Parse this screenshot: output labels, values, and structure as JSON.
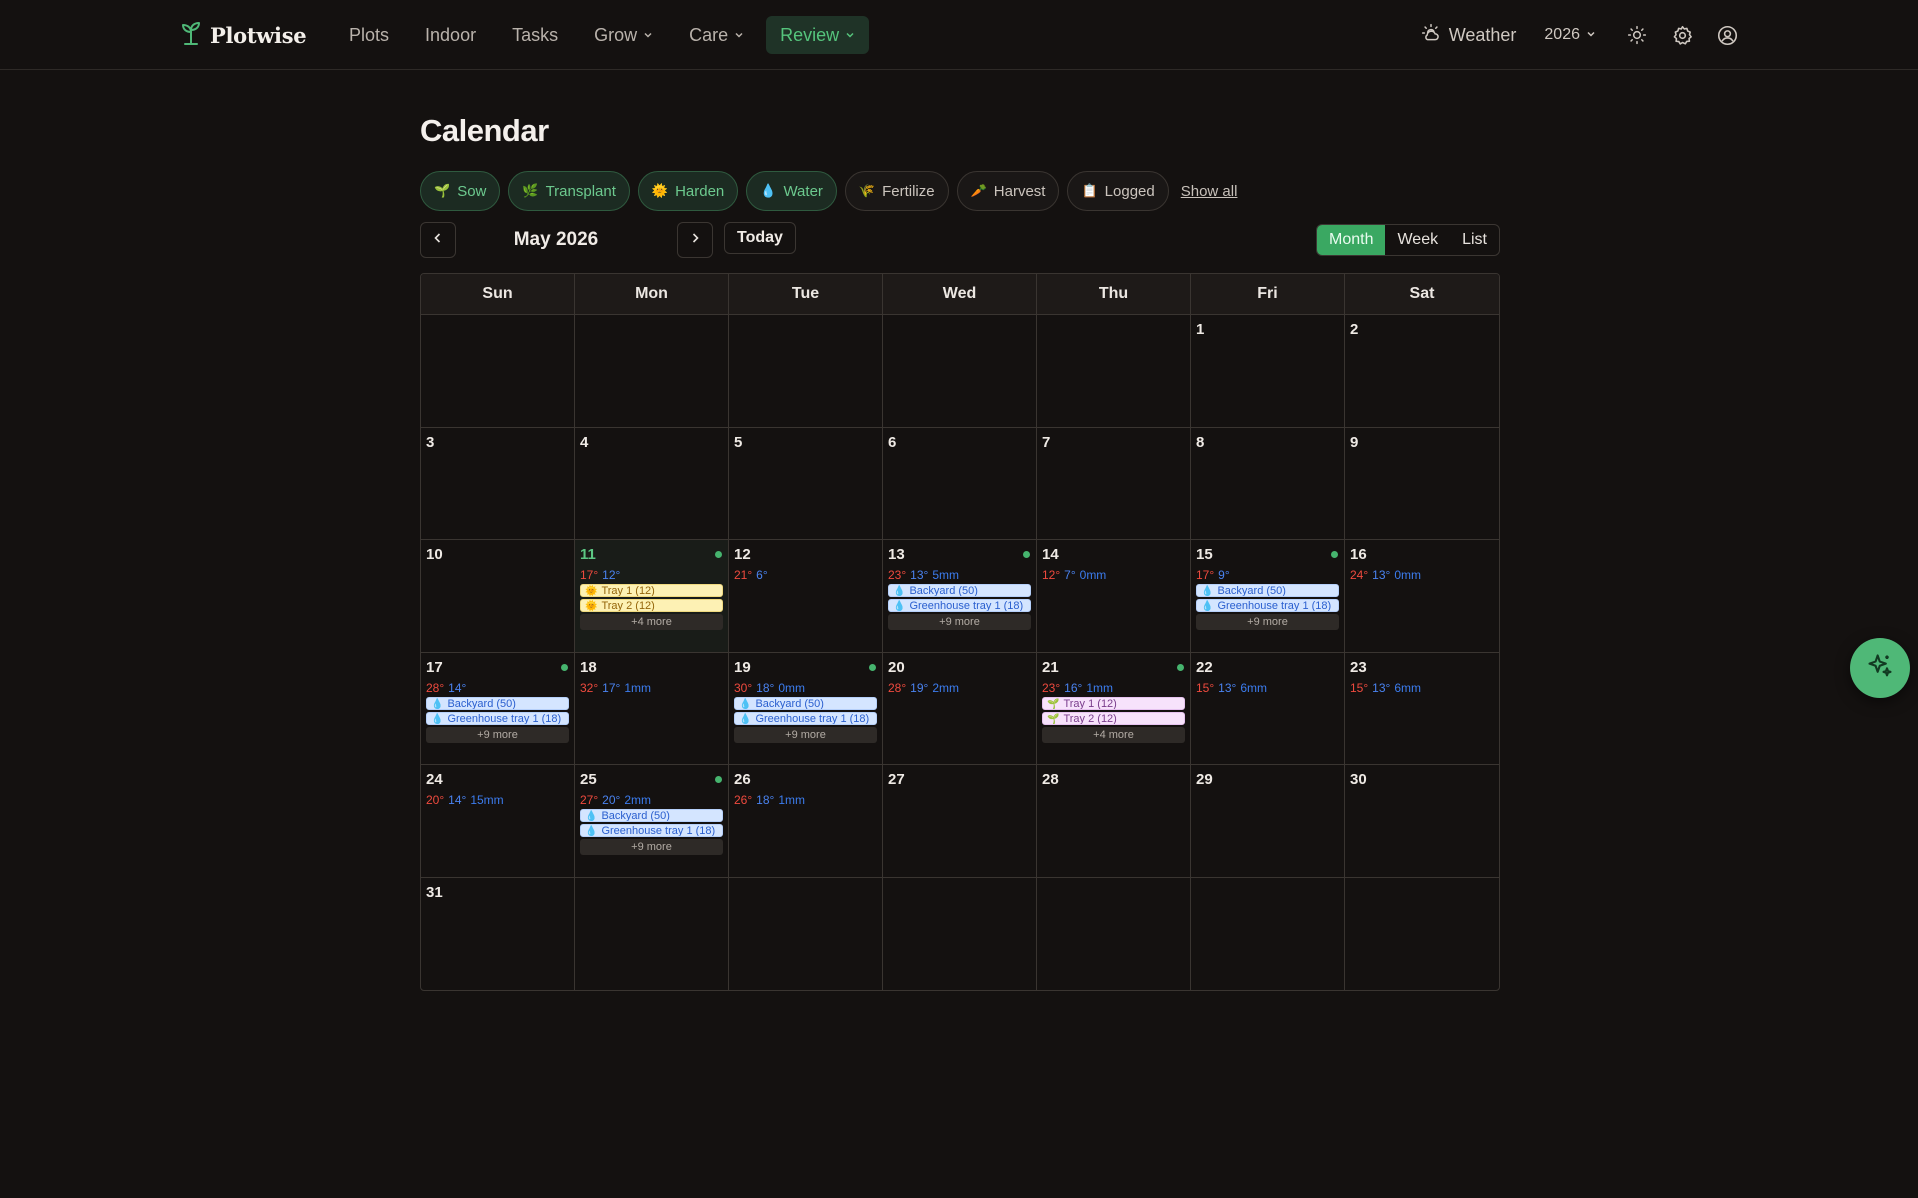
{
  "brand": {
    "name": "Plotwise",
    "accent": "#4fb877"
  },
  "nav": {
    "items": [
      {
        "label": "Plots",
        "dropdown": false
      },
      {
        "label": "Indoor",
        "dropdown": false
      },
      {
        "label": "Tasks",
        "dropdown": false
      },
      {
        "label": "Grow",
        "dropdown": true
      },
      {
        "label": "Care",
        "dropdown": true
      },
      {
        "label": "Review",
        "dropdown": true,
        "active": true
      }
    ],
    "weather_label": "Weather",
    "year": "2026",
    "icons": [
      "sun-icon",
      "gear-icon",
      "user-circle-icon"
    ]
  },
  "page": {
    "title": "Calendar"
  },
  "filters": {
    "chips": [
      {
        "emoji": "🌱",
        "label": "Sow",
        "active": true
      },
      {
        "emoji": "🌿",
        "label": "Transplant",
        "active": true
      },
      {
        "emoji": "🌞",
        "label": "Harden",
        "active": true
      },
      {
        "emoji": "💧",
        "label": "Water",
        "active": true
      },
      {
        "emoji": "🌾",
        "label": "Fertilize",
        "active": false
      },
      {
        "emoji": "🥕",
        "label": "Harvest",
        "active": false
      },
      {
        "emoji": "📋",
        "label": "Logged",
        "active": false
      }
    ],
    "show_all": "Show all"
  },
  "calendar_nav": {
    "month_label": "May 2026",
    "today_label": "Today",
    "views": [
      {
        "label": "Month",
        "selected": true
      },
      {
        "label": "Week",
        "selected": false
      },
      {
        "label": "List",
        "selected": false
      }
    ]
  },
  "weekdays": [
    "Sun",
    "Mon",
    "Tue",
    "Wed",
    "Thu",
    "Fri",
    "Sat"
  ],
  "days": [
    {
      "day": ""
    },
    {
      "day": ""
    },
    {
      "day": ""
    },
    {
      "day": ""
    },
    {
      "day": ""
    },
    {
      "day": "1"
    },
    {
      "day": "2"
    },
    {
      "day": "3"
    },
    {
      "day": "4"
    },
    {
      "day": "5"
    },
    {
      "day": "6"
    },
    {
      "day": "7"
    },
    {
      "day": "8"
    },
    {
      "day": "9"
    },
    {
      "day": "10"
    },
    {
      "day": "11",
      "today": true,
      "dot": true,
      "hi": "17°",
      "lo": "12°",
      "rain": "",
      "events": [
        {
          "type": "harden",
          "emoji": "🌞",
          "label": "Tray 1 (12)"
        },
        {
          "type": "harden",
          "emoji": "🌞",
          "label": "Tray 2 (12)"
        }
      ],
      "more": "+4 more"
    },
    {
      "day": "12",
      "hi": "21°",
      "lo": "6°",
      "rain": ""
    },
    {
      "day": "13",
      "dot": true,
      "hi": "23°",
      "lo": "13°",
      "rain": "5mm",
      "events": [
        {
          "type": "water",
          "emoji": "💧",
          "label": "Backyard (50)"
        },
        {
          "type": "water",
          "emoji": "💧",
          "label": "Greenhouse tray 1 (18)"
        }
      ],
      "more": "+9 more"
    },
    {
      "day": "14",
      "hi": "12°",
      "lo": "7°",
      "rain": "0mm"
    },
    {
      "day": "15",
      "dot": true,
      "hi": "17°",
      "lo": "9°",
      "rain": "",
      "events": [
        {
          "type": "water",
          "emoji": "💧",
          "label": "Backyard (50)"
        },
        {
          "type": "water",
          "emoji": "💧",
          "label": "Greenhouse tray 1 (18)"
        }
      ],
      "more": "+9 more"
    },
    {
      "day": "16",
      "hi": "24°",
      "lo": "13°",
      "rain": "0mm"
    },
    {
      "day": "17",
      "dot": true,
      "hi": "28°",
      "lo": "14°",
      "rain": "",
      "events": [
        {
          "type": "water",
          "emoji": "💧",
          "label": "Backyard (50)"
        },
        {
          "type": "water",
          "emoji": "💧",
          "label": "Greenhouse tray 1 (18)"
        }
      ],
      "more": "+9 more"
    },
    {
      "day": "18",
      "hi": "32°",
      "lo": "17°",
      "rain": "1mm"
    },
    {
      "day": "19",
      "dot": true,
      "hi": "30°",
      "lo": "18°",
      "rain": "0mm",
      "events": [
        {
          "type": "water",
          "emoji": "💧",
          "label": "Backyard (50)"
        },
        {
          "type": "water",
          "emoji": "💧",
          "label": "Greenhouse tray 1 (18)"
        }
      ],
      "more": "+9 more"
    },
    {
      "day": "20",
      "hi": "28°",
      "lo": "19°",
      "rain": "2mm"
    },
    {
      "day": "21",
      "dot": true,
      "hi": "23°",
      "lo": "16°",
      "rain": "1mm",
      "events": [
        {
          "type": "sow",
          "emoji": "🌱",
          "label": "Tray 1 (12)"
        },
        {
          "type": "sow",
          "emoji": "🌱",
          "label": "Tray 2 (12)"
        }
      ],
      "more": "+4 more"
    },
    {
      "day": "22",
      "hi": "15°",
      "lo": "13°",
      "rain": "6mm"
    },
    {
      "day": "23",
      "hi": "15°",
      "lo": "13°",
      "rain": "6mm"
    },
    {
      "day": "24",
      "hi": "20°",
      "lo": "14°",
      "rain": "15mm"
    },
    {
      "day": "25",
      "dot": true,
      "hi": "27°",
      "lo": "20°",
      "rain": "2mm",
      "events": [
        {
          "type": "water",
          "emoji": "💧",
          "label": "Backyard (50)"
        },
        {
          "type": "water",
          "emoji": "💧",
          "label": "Greenhouse tray 1 (18)"
        }
      ],
      "more": "+9 more"
    },
    {
      "day": "26",
      "hi": "26°",
      "lo": "18°",
      "rain": "1mm"
    },
    {
      "day": "27"
    },
    {
      "day": "28"
    },
    {
      "day": "29"
    },
    {
      "day": "30"
    },
    {
      "day": "31"
    },
    {
      "day": ""
    },
    {
      "day": ""
    },
    {
      "day": ""
    },
    {
      "day": ""
    },
    {
      "day": ""
    },
    {
      "day": ""
    }
  ],
  "colors": {
    "hi_temp": "#ef4a3e",
    "lo_temp": "#4a83f0",
    "accent": "#3aa862"
  },
  "fab": {
    "icon": "sparkle-icon"
  }
}
